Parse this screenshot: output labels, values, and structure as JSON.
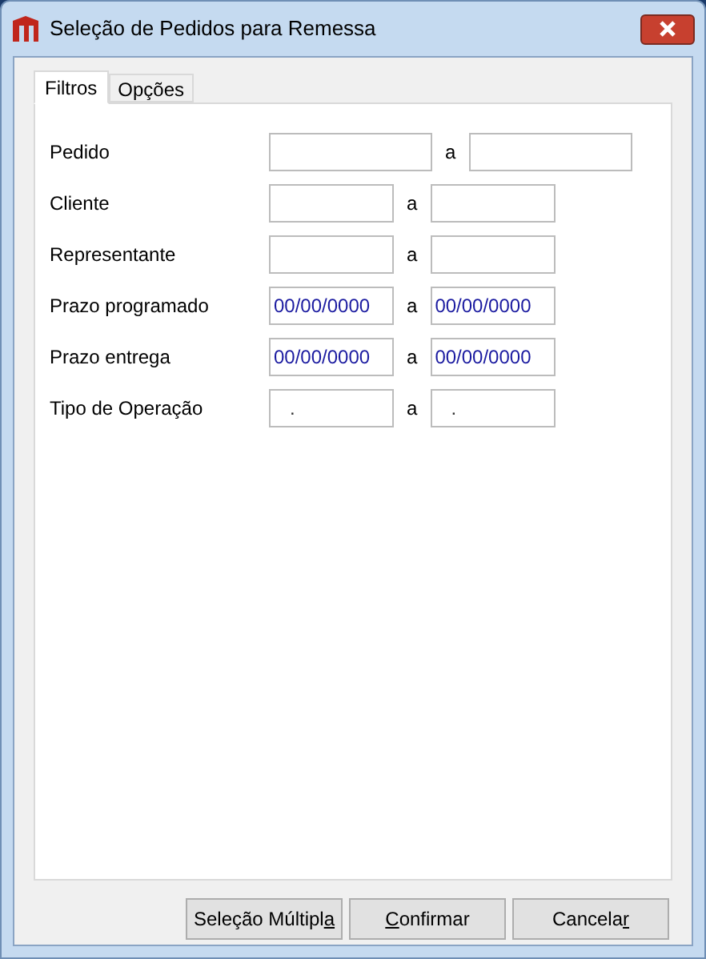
{
  "window": {
    "title": "Seleção de Pedidos para Remessa"
  },
  "tabs": [
    {
      "label": "Filtros",
      "selected": true
    },
    {
      "label": "Opções",
      "selected": false
    }
  ],
  "filters": [
    {
      "label": "Pedido",
      "kind": "wide",
      "separator": "a"
    },
    {
      "label": "Cliente",
      "kind": "text",
      "separator": "a"
    },
    {
      "label": "Representante",
      "kind": "text",
      "separator": "a"
    },
    {
      "label": "Prazo programado",
      "kind": "date",
      "separator": "a",
      "from": {
        "value": "00/00/0000"
      },
      "to": {
        "value": "00/00/0000"
      }
    },
    {
      "label": "Prazo entrega",
      "kind": "date",
      "separator": "a",
      "from": {
        "value": "00/00/0000"
      },
      "to": {
        "value": "00/00/0000"
      }
    },
    {
      "label": "Tipo de Operação",
      "kind": "code",
      "separator": "a",
      "from": {
        "value": "."
      },
      "to": {
        "value": "."
      }
    }
  ],
  "buttons": [
    {
      "before": "Seleção Múltipl",
      "mnemonic": "a"
    },
    {
      "mnemonic": "C",
      "after": "onfirmar"
    },
    {
      "before": "Cancela",
      "mnemonic": "r"
    }
  ]
}
